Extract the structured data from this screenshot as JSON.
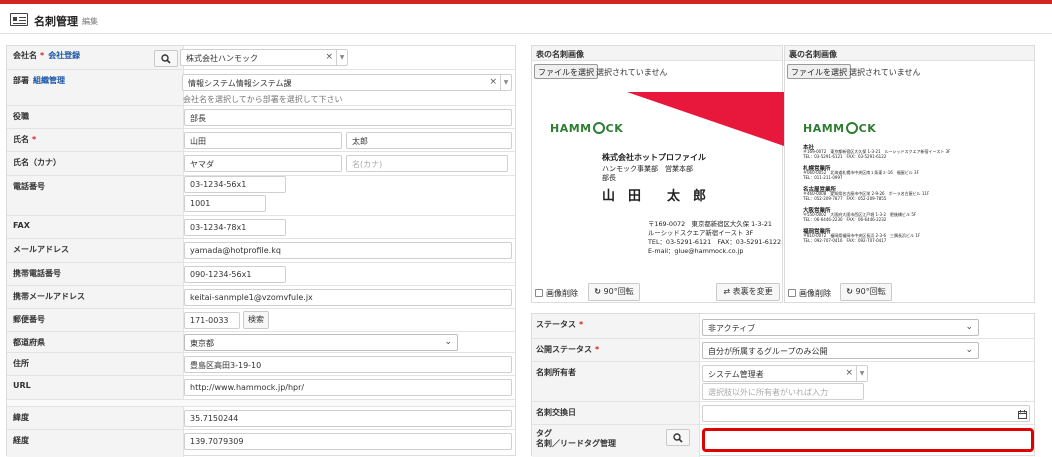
{
  "header": {
    "title": "名刺管理",
    "subtitle": "編集"
  },
  "form": {
    "company": {
      "label": "会社名",
      "required": "*",
      "link": "会社登録",
      "value": "株式会社ハンモック"
    },
    "dept": {
      "label": "部署",
      "link": "組織管理",
      "value": "情報システム情報システム課",
      "hint": "会社名を選択してから部署を選択して下さい"
    },
    "title": {
      "label": "役職",
      "value": "部長"
    },
    "name": {
      "label": "氏名",
      "required": "*",
      "last": "山田",
      "first": "太郎"
    },
    "kana": {
      "label": "氏名（カナ）",
      "last": "ヤマダ",
      "first_placeholder": "名(カナ)"
    },
    "phone": {
      "label": "電話番号",
      "value": "03-1234-56x1",
      "ext": "1001"
    },
    "fax": {
      "label": "FAX",
      "value": "03-1234-78x1"
    },
    "email": {
      "label": "メールアドレス",
      "value": "yamada@hotprofile.kq"
    },
    "mobile": {
      "label": "携帯電話番号",
      "value": "090-1234-56x1"
    },
    "mobile_email": {
      "label": "携帯メールアドレス",
      "value": "keitai-sanmple1@vzomvfule.jx"
    },
    "zip": {
      "label": "郵便番号",
      "value": "171-0033",
      "search_label": "検索"
    },
    "pref": {
      "label": "都道府県",
      "value": "東京都"
    },
    "address": {
      "label": "住所",
      "value": "豊島区高田3-19-10"
    },
    "url": {
      "label": "URL",
      "value": "http://www.hammock.jp/hpr/"
    },
    "lat": {
      "label": "緯度",
      "value": "35.7150244"
    },
    "lng": {
      "label": "経度",
      "value": "139.7079309"
    }
  },
  "front": {
    "heading": "表の名刺画像",
    "file_button": "ファイルを選択",
    "file_status": "選択されていません",
    "delete_label": "画像削除",
    "rotate_label": "90°回転",
    "swap_label": "表裏を変更",
    "card": {
      "logo_left": "HAMM",
      "logo_right": "CK",
      "company": "株式会社ホットプロファイル",
      "dept": "ハンモック事業部　営業本部",
      "role": "部長",
      "name": "山　田　　太　郎",
      "addr1": "〒169-0072　東京都新宿区大久保 1-3-21",
      "addr2": "ルーシッドスクエア新宿イースト 3F",
      "tel": "TEL：03-5291-6121　FAX：03-5291-6122",
      "mail": "E-mail：glue@hammock.co.jp"
    }
  },
  "back": {
    "heading": "裏の名刺画像",
    "file_button": "ファイルを選択",
    "file_status": "選択されていません",
    "delete_label": "画像削除",
    "rotate_label": "90°回転",
    "card": {
      "logo_left": "HAMM",
      "logo_right": "CK",
      "offices": [
        {
          "name": "本社",
          "l1": "〒169-0072　東京都新宿区大久保 1-3-21　ルーシッドスクエア新宿イースト 3F",
          "l2": "TEL：03-5291-6121　FAX：03-5291-6122"
        },
        {
          "name": "札幌営業所",
          "l1": "〒060-0052　北海道札幌市中央区南１条東２-16　福屋ビル 3F",
          "l2": "TEL：011-211-0997"
        },
        {
          "name": "名古屋営業所",
          "l1": "〒460-0008　愛知県名古屋市中区栄 2-9-26　ポーラ名古屋ビル 11F",
          "l2": "TEL：052-209-7877　FAX：052-209-7855"
        },
        {
          "name": "大阪営業所",
          "l1": "〒550-0002　大阪府大阪市西区江戸堀 1-3-2　肥後橋ビル 5F",
          "l2": "TEL：06-6446-2230　FAX：06-6446-2232"
        },
        {
          "name": "福岡営業所",
          "l1": "〒810-0072　福岡県福岡市中央区長浜 2-3-6　三隅長浜ビル 1F",
          "l2": "TEL：092-707-0416　FAX：092-707-0417"
        }
      ]
    }
  },
  "right": {
    "status": {
      "label": "ステータス",
      "required": "*",
      "value": "非アクティブ"
    },
    "pub": {
      "label": "公開ステータス",
      "required": "*",
      "value": "自分が所属するグループのみ公開"
    },
    "owner": {
      "label": "名刺所有者",
      "value": "システム管理者",
      "placeholder": "選択肢以外に所有者がいれば入力"
    },
    "exchange": {
      "label": "名刺交換日"
    },
    "tag": {
      "label": "タグ",
      "links": "名刺／リードタグ管理"
    }
  },
  "colors": {
    "accent": "#d32323",
    "link": "#1a56a6",
    "logo": "#2e7d32",
    "highlight": "#e00000"
  }
}
